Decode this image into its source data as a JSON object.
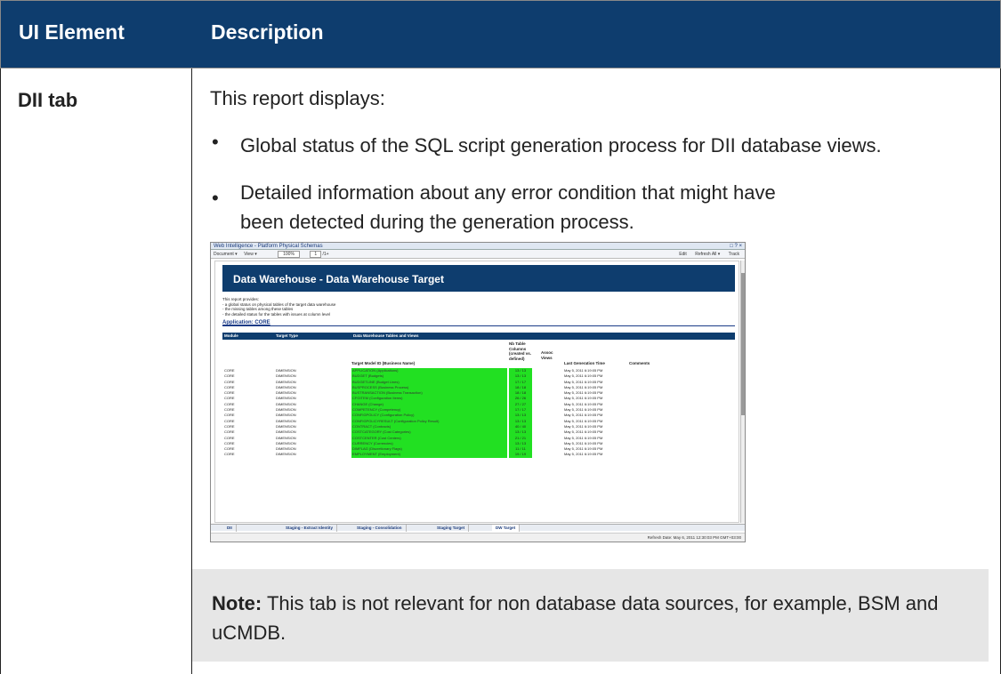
{
  "header": {
    "col1": "UI Element",
    "col2": "Description"
  },
  "row": {
    "element": "DII tab",
    "intro": "This report displays:",
    "bullets": [
      "Global status of the SQL script generation process for DII database views.",
      "Detailed information about any error condition that might have been detected during the generation process."
    ],
    "note_label": "Note:",
    "note_text": "This tab is not relevant for non database data sources, for example, BSM and uCMDB."
  },
  "screenshot": {
    "window_title": "Web Intelligence - Platform Physical Schemas",
    "toolbar": {
      "document": "Document ▾",
      "view": "View ▾",
      "zoom": "100%",
      "page": "1",
      "page_total": "/1+",
      "edit": "Edit",
      "refresh": "Refresh All ▾",
      "track": "Track"
    },
    "report_title": "Data Warehouse - Data Warehouse Target",
    "report_intro": [
      "This report provides:",
      " - a global status on physical tables of the target data warehouse",
      " - the missing tables among these tables",
      " - the detailed status for the tables with issues at column level"
    ],
    "application": "Application: CORE",
    "table_headers": {
      "module": "Module",
      "target_type": "Target Type",
      "tables_views": "Data Warehouse Tables and Views"
    },
    "sub_headers": {
      "target_model": "Target Model ID (Business Name)",
      "columns": "Nb Table Columns (created vs. defined)",
      "assoc": "Assoc Views",
      "last_gen": "Last Generation Time",
      "comments": "Comments"
    },
    "rows": [
      {
        "module": "CORE",
        "type": "DIMENSION",
        "model": "APPLICATION (Applications)",
        "cols": "13 / 13",
        "time": "May 5, 2011 6:19:05 PM"
      },
      {
        "module": "CORE",
        "type": "DIMENSION",
        "model": "BUDGET (Budgets)",
        "cols": "13 / 13",
        "time": "May 5, 2011 6:19:05 PM"
      },
      {
        "module": "CORE",
        "type": "DIMENSION",
        "model": "BUDGETLINE (Budget Lines)",
        "cols": "17 / 17",
        "time": "May 5, 2011 6:19:05 PM"
      },
      {
        "module": "CORE",
        "type": "DIMENSION",
        "model": "BUSPROCESS (Business Process)",
        "cols": "18 / 18",
        "time": "May 5, 2011 6:19:05 PM"
      },
      {
        "module": "CORE",
        "type": "DIMENSION",
        "model": "BUSTRANSACTION (Business Transaction)",
        "cols": "18 / 18",
        "time": "May 5, 2011 6:19:05 PM"
      },
      {
        "module": "CORE",
        "type": "DIMENSION",
        "model": "CFGITEM (Configuration Items)",
        "cols": "26 / 26",
        "time": "May 5, 2011 6:19:05 PM"
      },
      {
        "module": "CORE",
        "type": "DIMENSION",
        "model": "CHANGE (Change)",
        "cols": "27 / 27",
        "time": "May 5, 2011 6:19:05 PM"
      },
      {
        "module": "CORE",
        "type": "DIMENSION",
        "model": "COMPETENCY (Competency)",
        "cols": "17 / 17",
        "time": "May 5, 2011 6:19:05 PM"
      },
      {
        "module": "CORE",
        "type": "DIMENSION",
        "model": "CONFIGPOLICY (Configuration Policy)",
        "cols": "13 / 13",
        "time": "May 5, 2011 6:19:05 PM"
      },
      {
        "module": "CORE",
        "type": "DIMENSION",
        "model": "CONFIGPOLICYRESULT (Configuration Policy Result)",
        "cols": "13 / 13",
        "time": "May 5, 2011 6:19:05 PM"
      },
      {
        "module": "CORE",
        "type": "DIMENSION",
        "model": "CONTRACT (Contracts)",
        "cols": "40 / 40",
        "time": "May 5, 2011 6:19:05 PM"
      },
      {
        "module": "CORE",
        "type": "DIMENSION",
        "model": "COSTCATEGORY (Cost Categories)",
        "cols": "13 / 13",
        "time": "May 5, 2011 6:19:05 PM"
      },
      {
        "module": "CORE",
        "type": "DIMENSION",
        "model": "COSTCENTER (Cost Centers)",
        "cols": "21 / 21",
        "time": "May 5, 2011 6:19:05 PM"
      },
      {
        "module": "CORE",
        "type": "DIMENSION",
        "model": "CURRENCY (Currencies)",
        "cols": "13 / 13",
        "time": "May 5, 2011 6:19:05 PM"
      },
      {
        "module": "CORE",
        "type": "DIMENSION",
        "model": "DIMFLAG (Discretionary Flags)",
        "cols": "11 / 11",
        "time": "May 5, 2011 6:19:05 PM"
      },
      {
        "module": "CORE",
        "type": "DIMENSION",
        "model": "EMPLOYMENT (Employment)",
        "cols": "19 / 19",
        "time": "May 5, 2011 6:19:05 PM"
      }
    ],
    "tabs": [
      "DII",
      "Staging - Extract Identity",
      "Staging - Consolidation",
      "Staging Target",
      "DW Target"
    ],
    "status": "Refresh Date: May 6, 2011 12:30:03 PM GMT+03:00"
  }
}
